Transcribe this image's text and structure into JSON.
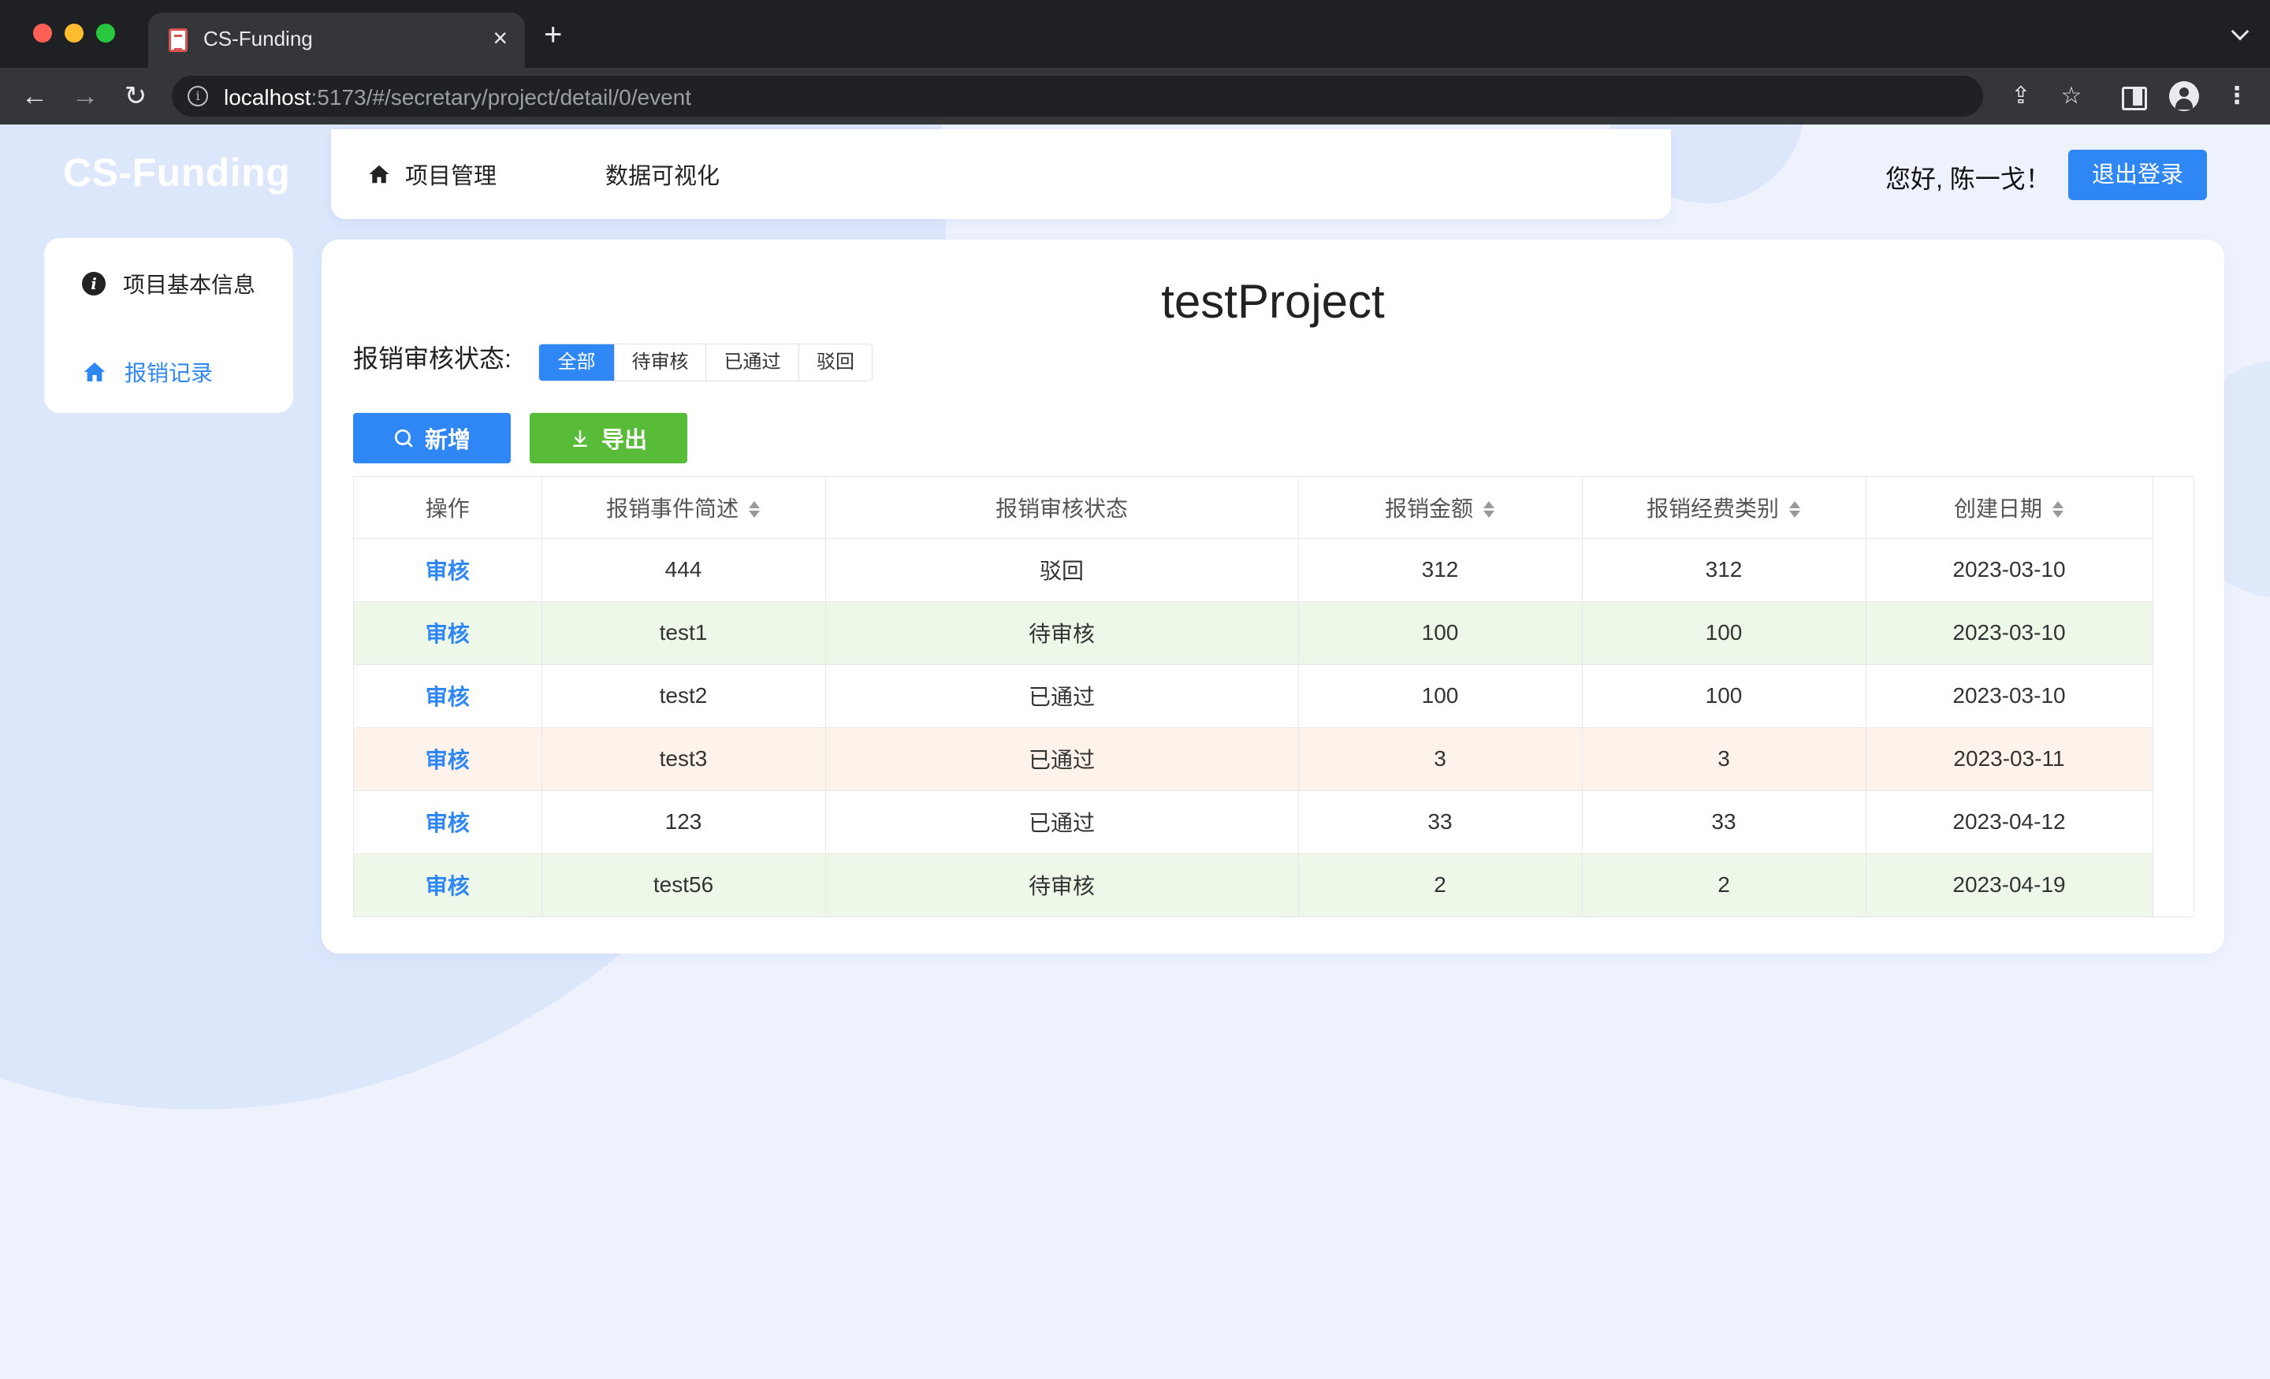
{
  "browser": {
    "tab_title": "CS-Funding",
    "tab_close": "×",
    "new_tab": "+",
    "url_host": "localhost",
    "url_path": ":5173/#/secretary/project/detail/0/event"
  },
  "app": {
    "logo": "CS-Funding",
    "nav": [
      {
        "label": "项目管理",
        "icon": "home-icon"
      },
      {
        "label": "数据可视化"
      }
    ],
    "greeting": "您好, 陈一戈！",
    "logout": "退出登录"
  },
  "sidebar": {
    "items": [
      {
        "label": "项目基本信息",
        "icon": "info-icon"
      },
      {
        "label": "报销记录",
        "icon": "home-icon",
        "active": true
      }
    ]
  },
  "main": {
    "title": "testProject",
    "filter_label": "报销审核状态:",
    "filters": [
      "全部",
      "待审核",
      "已通过",
      "驳回"
    ],
    "active_filter": "全部",
    "add_button": "新增",
    "export_button": "导出",
    "columns": [
      "操作",
      "报销事件简述",
      "报销审核状态",
      "报销金额",
      "报销经费类别",
      "创建日期"
    ],
    "rows": [
      {
        "action": "审核",
        "desc": "444",
        "status": "驳回",
        "amount": "312",
        "category": "312",
        "date": "2023-03-10"
      },
      {
        "action": "审核",
        "desc": "test1",
        "status": "待审核",
        "amount": "100",
        "category": "100",
        "date": "2023-03-10"
      },
      {
        "action": "审核",
        "desc": "test2",
        "status": "已通过",
        "amount": "100",
        "category": "100",
        "date": "2023-03-10"
      },
      {
        "action": "审核",
        "desc": "test3",
        "status": "已通过",
        "amount": "3",
        "category": "3",
        "date": "2023-03-11"
      },
      {
        "action": "审核",
        "desc": "123",
        "status": "已通过",
        "amount": "33",
        "category": "33",
        "date": "2023-04-12"
      },
      {
        "action": "审核",
        "desc": "test56",
        "status": "待审核",
        "amount": "2",
        "category": "2",
        "date": "2023-04-19"
      }
    ]
  },
  "colors": {
    "primary": "#2e87f5",
    "success": "#58bc38",
    "row_green": "#edf8e8",
    "row_orange": "#fdf3ea",
    "page_bg": "#edf2fd"
  }
}
